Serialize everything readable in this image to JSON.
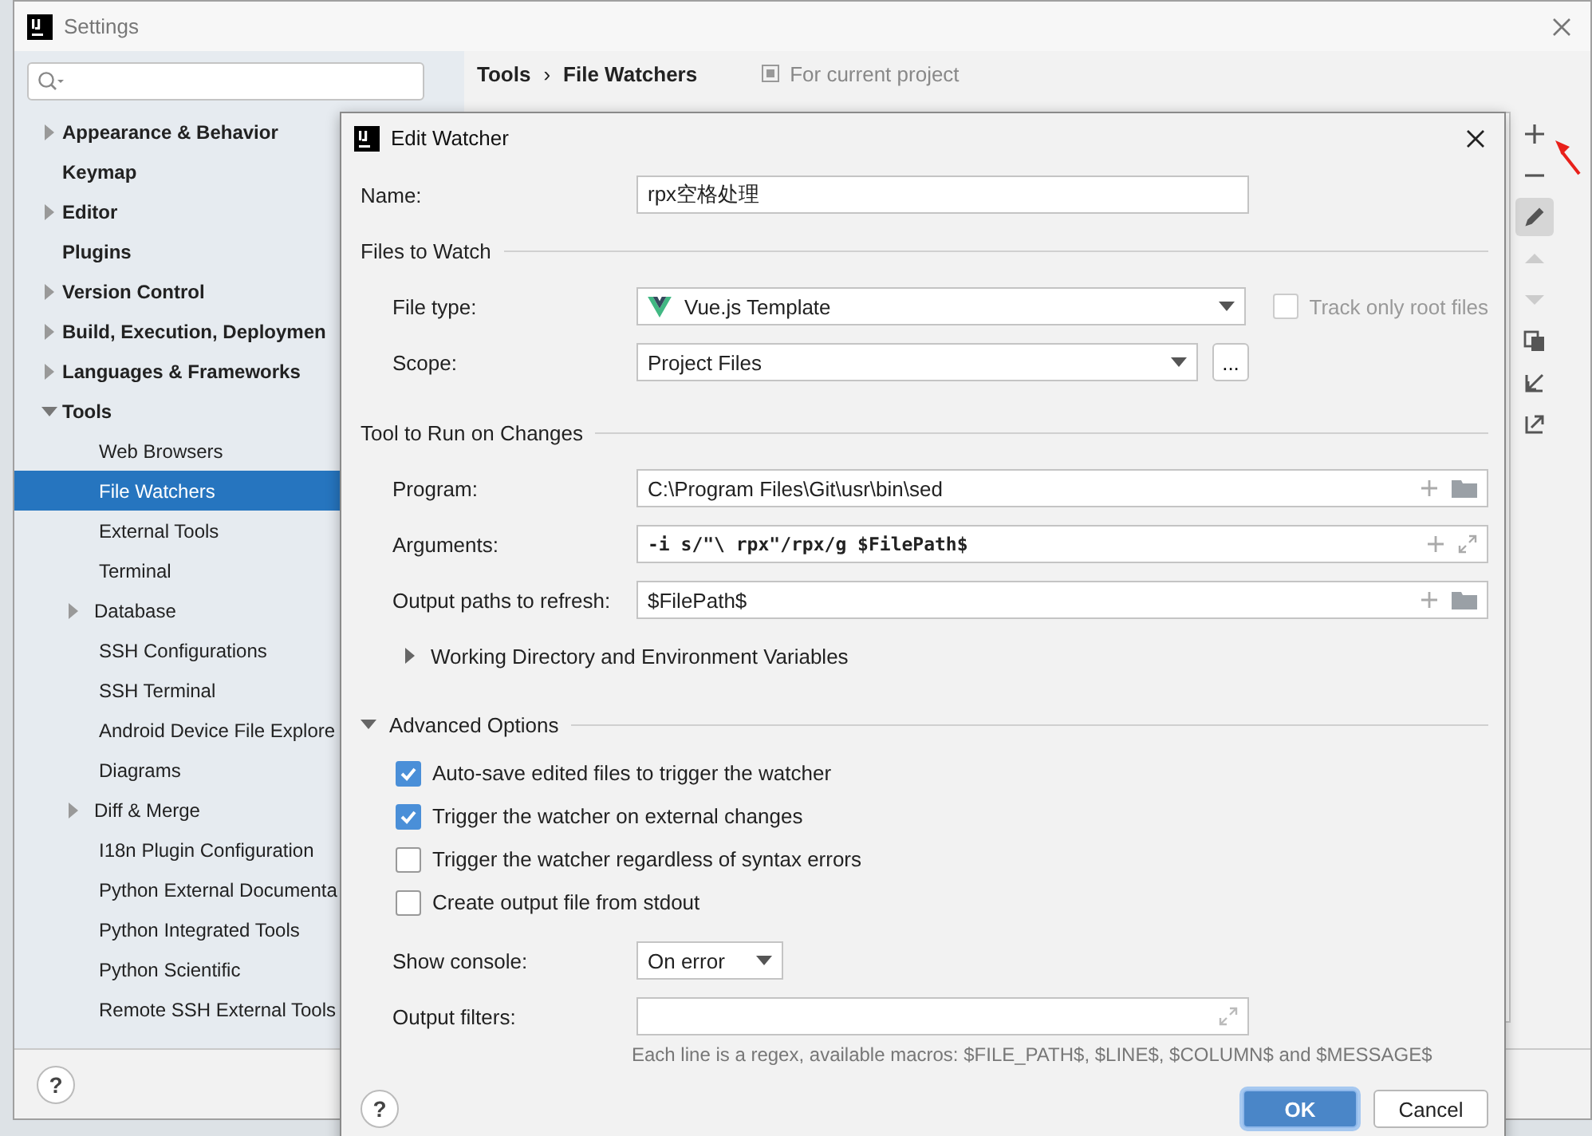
{
  "window": {
    "title": "Settings",
    "help": "?"
  },
  "sidebar": {
    "items": [
      {
        "label": "Appearance & Behavior",
        "kind": "group",
        "expanded": false,
        "selected": false
      },
      {
        "label": "Keymap",
        "kind": "leaf",
        "selected": false
      },
      {
        "label": "Editor",
        "kind": "group",
        "expanded": false,
        "selected": false
      },
      {
        "label": "Plugins",
        "kind": "leaf",
        "selected": false
      },
      {
        "label": "Version Control",
        "kind": "group",
        "expanded": false,
        "selected": false
      },
      {
        "label": "Build, Execution, Deploymen",
        "kind": "group",
        "expanded": false,
        "selected": false
      },
      {
        "label": "Languages & Frameworks",
        "kind": "group",
        "expanded": false,
        "selected": false
      },
      {
        "label": "Tools",
        "kind": "group",
        "expanded": true,
        "selected": false,
        "children": [
          {
            "label": "Web Browsers",
            "kind": "leaf",
            "selected": false
          },
          {
            "label": "File Watchers",
            "kind": "leaf",
            "selected": true
          },
          {
            "label": "External Tools",
            "kind": "leaf",
            "selected": false
          },
          {
            "label": "Terminal",
            "kind": "leaf",
            "selected": false
          },
          {
            "label": "Database",
            "kind": "group",
            "expanded": false,
            "selected": false
          },
          {
            "label": "SSH Configurations",
            "kind": "leaf",
            "selected": false
          },
          {
            "label": "SSH Terminal",
            "kind": "leaf",
            "selected": false
          },
          {
            "label": "Android Device File Explore",
            "kind": "leaf",
            "selected": false
          },
          {
            "label": "Diagrams",
            "kind": "leaf",
            "selected": false
          },
          {
            "label": "Diff & Merge",
            "kind": "group",
            "expanded": false,
            "selected": false
          },
          {
            "label": "I18n Plugin Configuration",
            "kind": "leaf",
            "selected": false
          },
          {
            "label": "Python External Documenta",
            "kind": "leaf",
            "selected": false
          },
          {
            "label": "Python Integrated Tools",
            "kind": "leaf",
            "selected": false
          },
          {
            "label": "Python Scientific",
            "kind": "leaf",
            "selected": false
          },
          {
            "label": "Remote SSH External Tools",
            "kind": "leaf",
            "selected": false
          }
        ]
      }
    ]
  },
  "breadcrumb": {
    "items": [
      "Tools",
      "File Watchers"
    ],
    "separator": "›"
  },
  "scope_note": "For current project",
  "toolbar": [
    {
      "kind": "add",
      "disabled": false,
      "selected": false
    },
    {
      "kind": "remove",
      "disabled": false,
      "selected": false
    },
    {
      "kind": "edit",
      "disabled": false,
      "selected": true
    },
    {
      "kind": "move-up",
      "disabled": true,
      "selected": false
    },
    {
      "kind": "move-down",
      "disabled": true,
      "selected": false
    },
    {
      "kind": "copy",
      "disabled": false,
      "selected": false
    },
    {
      "kind": "import",
      "disabled": false,
      "selected": false
    },
    {
      "kind": "export",
      "disabled": false,
      "selected": false
    }
  ],
  "dialog": {
    "title": "Edit Watcher",
    "name": {
      "label": "Name:",
      "value": "rpx空格处理"
    },
    "files_section": {
      "title": "Files to Watch",
      "file_type": {
        "label": "File type:",
        "value": "Vue.js Template"
      },
      "track_root": {
        "label": "Track only root files",
        "checked": false,
        "disabled": true
      },
      "scope": {
        "label": "Scope:",
        "value": "Project Files",
        "browse": "..."
      }
    },
    "tool_section": {
      "title": "Tool to Run on Changes",
      "fields": [
        {
          "label": "Program:",
          "value": "C:\\Program Files\\Git\\usr\\bin\\sed",
          "kind": "path"
        },
        {
          "label": "Arguments:",
          "value": "-i s/\"\\ rpx\"/rpx/g $FilePath$",
          "kind": "text"
        },
        {
          "label": "Output paths to refresh:",
          "value": "$FilePath$",
          "kind": "path"
        }
      ],
      "working_dir": {
        "label": "Working Directory and Environment Variables",
        "expanded": false
      }
    },
    "advanced": {
      "title": "Advanced Options",
      "expanded": true,
      "options": [
        {
          "label": "Auto-save edited files to trigger the watcher",
          "checked": true
        },
        {
          "label": "Trigger the watcher on external changes",
          "checked": true
        },
        {
          "label": "Trigger the watcher regardless of syntax errors",
          "checked": false
        },
        {
          "label": "Create output file from stdout",
          "checked": false
        }
      ],
      "show_console": {
        "label": "Show console:",
        "value": "On error"
      },
      "output_filters": {
        "label": "Output filters:"
      },
      "hint": "Each line is a regex, available macros: $FILE_PATH$, $LINE$, $COLUMN$ and $MESSAGE$"
    },
    "buttons": [
      {
        "label": "OK",
        "default": true
      },
      {
        "label": "Cancel",
        "default": false
      }
    ],
    "help": "?"
  }
}
